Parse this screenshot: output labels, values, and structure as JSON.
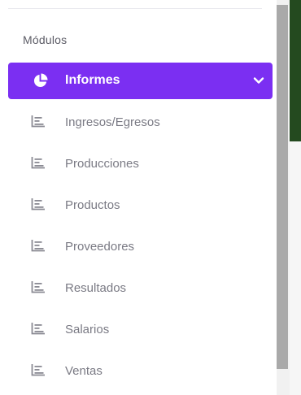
{
  "sidebar": {
    "section_title": "Módulos",
    "active_item": {
      "label": "Informes",
      "icon": "pie-chart-icon",
      "expanded": true
    },
    "items": [
      {
        "label": "Ingresos/Egresos",
        "icon": "chart-bars-icon"
      },
      {
        "label": "Producciones",
        "icon": "chart-bars-icon"
      },
      {
        "label": "Productos",
        "icon": "chart-bars-icon"
      },
      {
        "label": "Proveedores",
        "icon": "chart-bars-icon"
      },
      {
        "label": "Resultados",
        "icon": "chart-bars-icon"
      },
      {
        "label": "Salarios",
        "icon": "chart-bars-icon"
      },
      {
        "label": "Ventas",
        "icon": "chart-bars-icon"
      }
    ]
  },
  "colors": {
    "accent": "#7b2ff2",
    "text_muted": "#7a7a84",
    "panel_green": "#244a1f",
    "scrollbar_thumb": "#a9a9a9"
  }
}
